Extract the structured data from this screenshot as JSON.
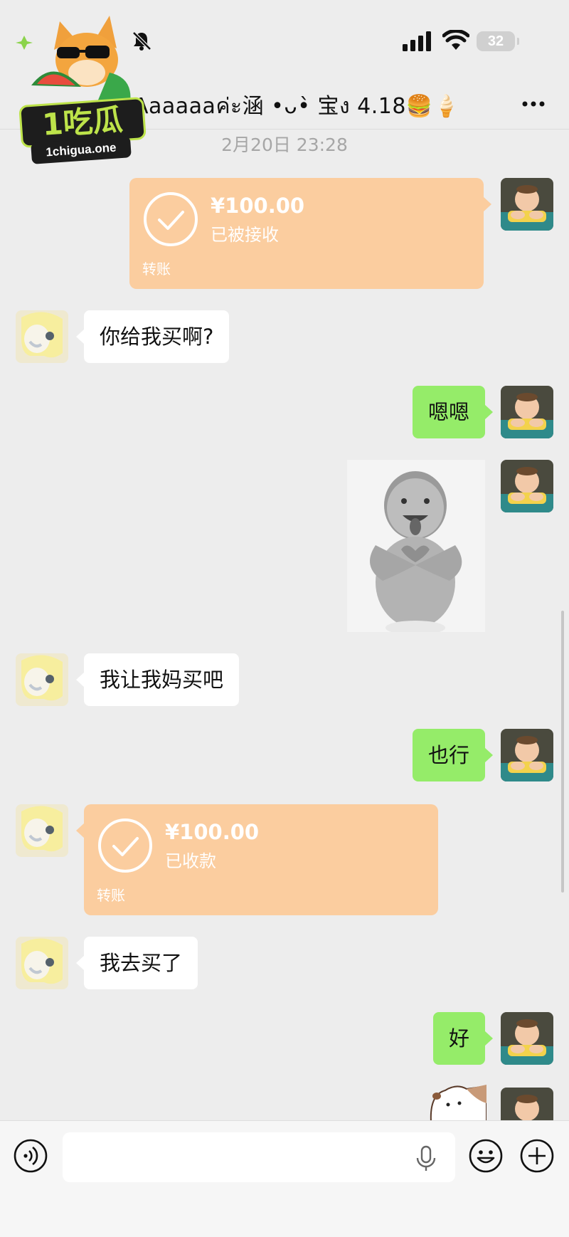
{
  "status_bar": {
    "battery": "32"
  },
  "header": {
    "contact_name": "Aaaaaaค่ะ涵 •ᴗ•̀ 宝ง 4.18🍔🍦"
  },
  "watermark": {
    "brand": "1吃瓜",
    "site": "1chigua.one"
  },
  "chat": {
    "timestamp": "2月20日 23:28",
    "messages": [
      {
        "from": "me",
        "type": "transfer",
        "amount": "¥100.00",
        "status": "已被接收",
        "label": "转账"
      },
      {
        "from": "them",
        "type": "text",
        "text": "你给我买啊?"
      },
      {
        "from": "me",
        "type": "text",
        "text": "嗯嗯"
      },
      {
        "from": "me",
        "type": "sticker",
        "description": "baby-heart-sticker"
      },
      {
        "from": "them",
        "type": "text",
        "text": "我让我妈买吧"
      },
      {
        "from": "me",
        "type": "text",
        "text": "也行"
      },
      {
        "from": "them",
        "type": "transfer",
        "amount": "¥100.00",
        "status": "已收款",
        "label": "转账"
      },
      {
        "from": "them",
        "type": "text",
        "text": "我去买了"
      },
      {
        "from": "me",
        "type": "text",
        "text": "好"
      }
    ]
  },
  "input_bar": {
    "placeholder": ""
  },
  "colors": {
    "background": "#ededed",
    "my_bubble": "#95ec69",
    "their_bubble": "#ffffff",
    "transfer": "#fbcd9f"
  }
}
